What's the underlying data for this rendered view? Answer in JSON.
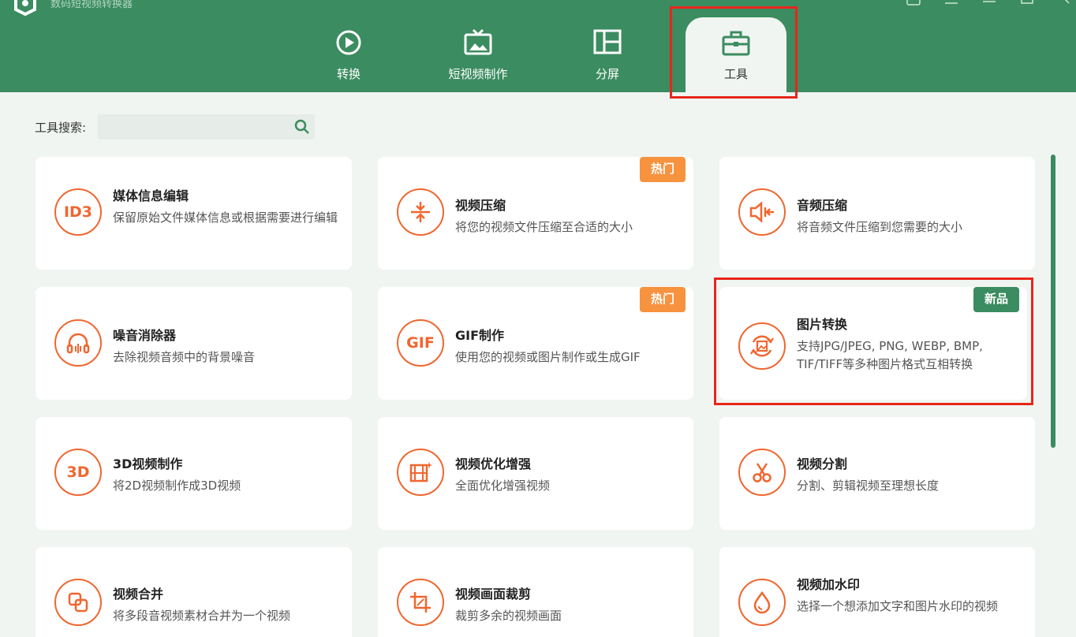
{
  "app": {
    "title": "数码短视频转换器"
  },
  "tabs": [
    {
      "label": "转换",
      "icon": "convert-icon"
    },
    {
      "label": "短视频制作",
      "icon": "short-video-icon"
    },
    {
      "label": "分屏",
      "icon": "split-screen-icon"
    },
    {
      "label": "工具",
      "icon": "toolbox-icon",
      "active": true
    }
  ],
  "search": {
    "label": "工具搜索:",
    "value": "",
    "placeholder": ""
  },
  "cards": [
    {
      "title": "媒体信息编辑",
      "desc": "保留原始文件媒体信息或根据需要进行编辑",
      "icon_text": "ID3",
      "icon": "id3-icon"
    },
    {
      "title": "视频压缩",
      "desc": "将您的视频文件压缩至合适的大小",
      "badge": "热门",
      "icon": "video-compress-icon"
    },
    {
      "title": "音频压缩",
      "desc": "将音频文件压缩到您需要的大小",
      "icon": "audio-compress-icon"
    },
    {
      "title": "噪音消除器",
      "desc": "去除视频音频中的背景噪音",
      "icon": "headphones-icon"
    },
    {
      "title": "GIF制作",
      "desc": "使用您的视频或图片制作或生成GIF",
      "badge": "热门",
      "icon_text": "GIF",
      "icon": "gif-icon"
    },
    {
      "title": "图片转换",
      "desc": "支持JPG/JPEG, PNG, WEBP, BMP, TIF/TIFF等多种图片格式互相转换",
      "badge": "新品",
      "icon": "image-convert-icon"
    },
    {
      "title": "3D视频制作",
      "desc": "将2D视频制作成3D视频",
      "icon_text": "3D",
      "icon": "3d-icon"
    },
    {
      "title": "视频优化增强",
      "desc": "全面优化增强视频",
      "icon": "video-enhance-icon"
    },
    {
      "title": "视频分割",
      "desc": "分割、剪辑视频至理想长度",
      "icon": "scissors-icon"
    },
    {
      "title": "视频合并",
      "desc": "将多段音视频素材合并为一个视频",
      "icon": "merge-icon"
    },
    {
      "title": "视频画面裁剪",
      "desc": "裁剪多余的视频画面",
      "icon": "crop-icon"
    },
    {
      "title": "视频加水印",
      "desc": "选择一个想添加文字和图片水印的视频",
      "icon": "watermark-icon"
    }
  ],
  "colors": {
    "brand": "#3b8c60",
    "accent": "#f0662f",
    "hot": "#f7923e",
    "highlight": "#e8261c"
  }
}
